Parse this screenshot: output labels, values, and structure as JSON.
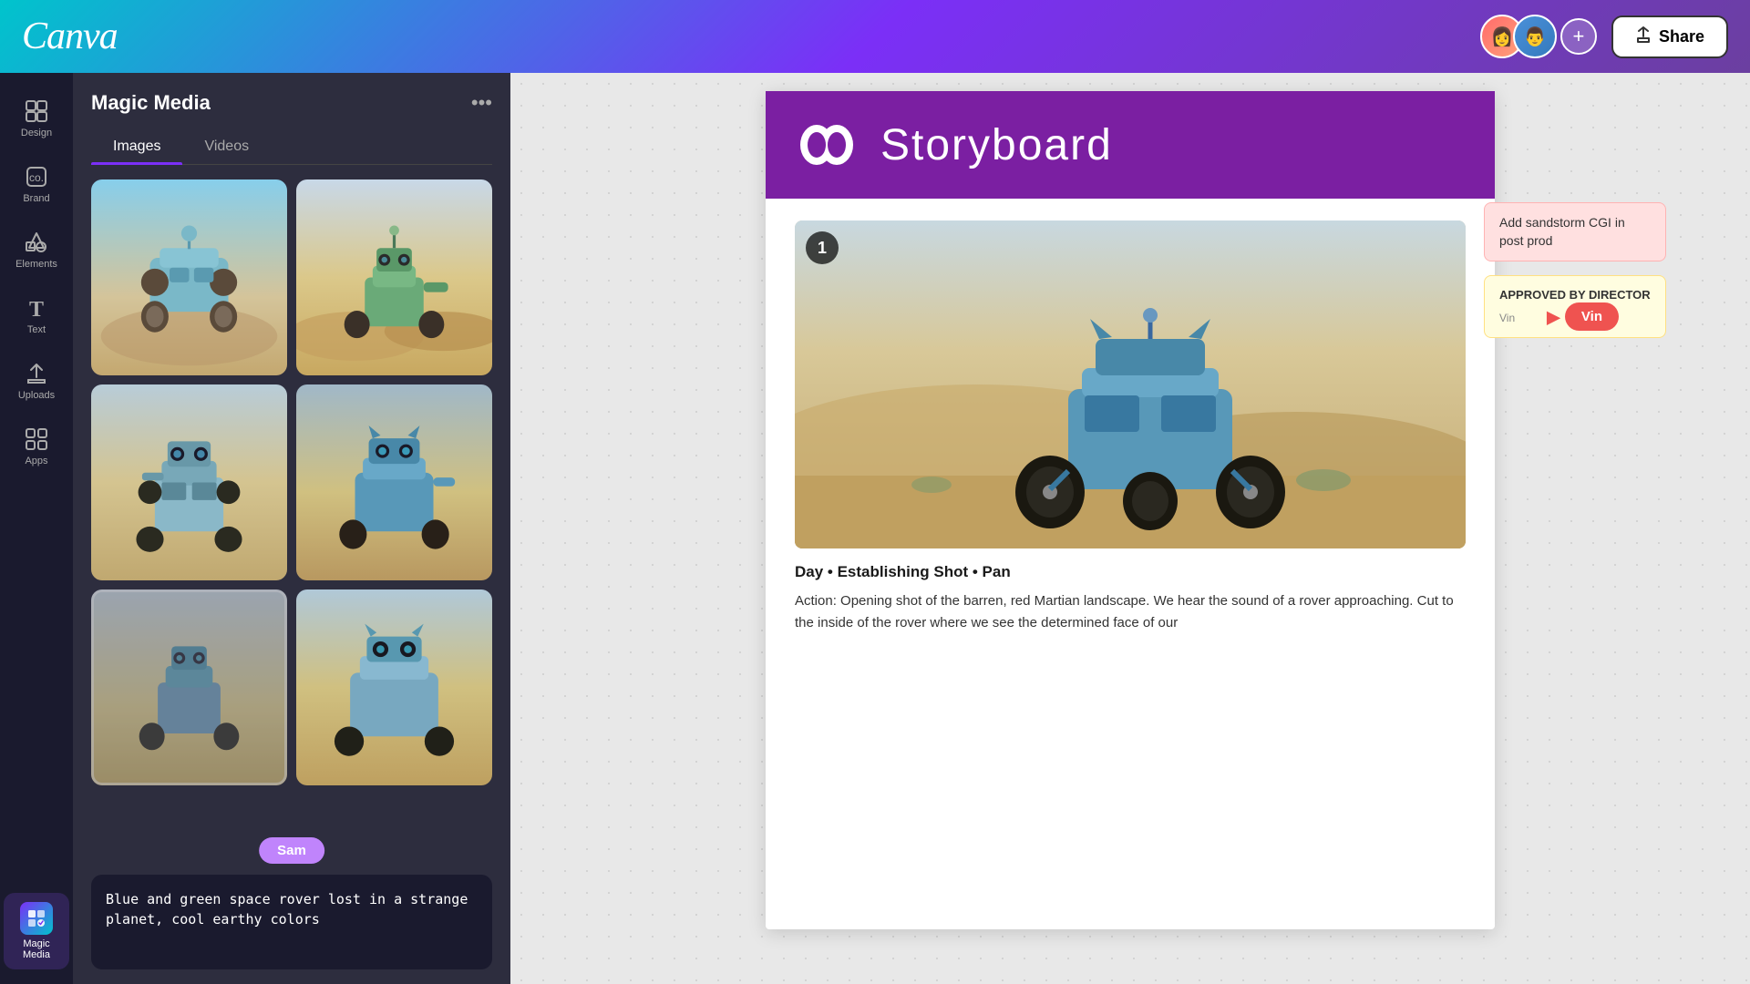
{
  "header": {
    "logo": "Canva",
    "share_label": "Share",
    "share_icon": "↑",
    "add_collaborator_icon": "+"
  },
  "sidebar": {
    "items": [
      {
        "id": "design",
        "label": "Design",
        "icon": "⊞"
      },
      {
        "id": "brand",
        "label": "Brand",
        "icon": "©"
      },
      {
        "id": "elements",
        "label": "Elements",
        "icon": "♡△"
      },
      {
        "id": "text",
        "label": "Text",
        "icon": "T"
      },
      {
        "id": "uploads",
        "label": "Uploads",
        "icon": "↑"
      },
      {
        "id": "apps",
        "label": "Apps",
        "icon": "⊞"
      }
    ],
    "active_item": "magic_media",
    "magic_media_label": "Magic Media"
  },
  "panel": {
    "title": "Magic Media",
    "more_icon": "•••",
    "tabs": [
      {
        "id": "images",
        "label": "Images",
        "active": true
      },
      {
        "id": "videos",
        "label": "Videos",
        "active": false
      }
    ],
    "images": [
      {
        "id": 1,
        "alt": "Blue rover on alien landscape - top view"
      },
      {
        "id": 2,
        "alt": "Green rover in desert"
      },
      {
        "id": 3,
        "alt": "Robot rover standing upright"
      },
      {
        "id": 4,
        "alt": "Blue-green robot rover"
      },
      {
        "id": 5,
        "alt": "Small robot rover dragging"
      },
      {
        "id": 6,
        "alt": "Robot rover close-up"
      }
    ],
    "prompt_label": "Blue and green space rover lost in a strange planet, cool earthy colors",
    "sam_cursor_label": "Sam"
  },
  "canvas": {
    "storyboard_title": "Storyboard",
    "scene": {
      "number": "1",
      "shot_info": "Day • Establishing Shot • Pan",
      "action_text": "Action: Opening shot of the barren, red Martian landscape. We hear the sound of a rover approaching. Cut to the inside of the rover where we see the determined face of our"
    },
    "annotations": {
      "sandstorm": {
        "text": "Add sandstorm CGI in post prod"
      },
      "approved": {
        "title": "APPROVED BY DIRECTOR",
        "user": "Vin"
      }
    },
    "vin_cursor_label": "Vin"
  }
}
